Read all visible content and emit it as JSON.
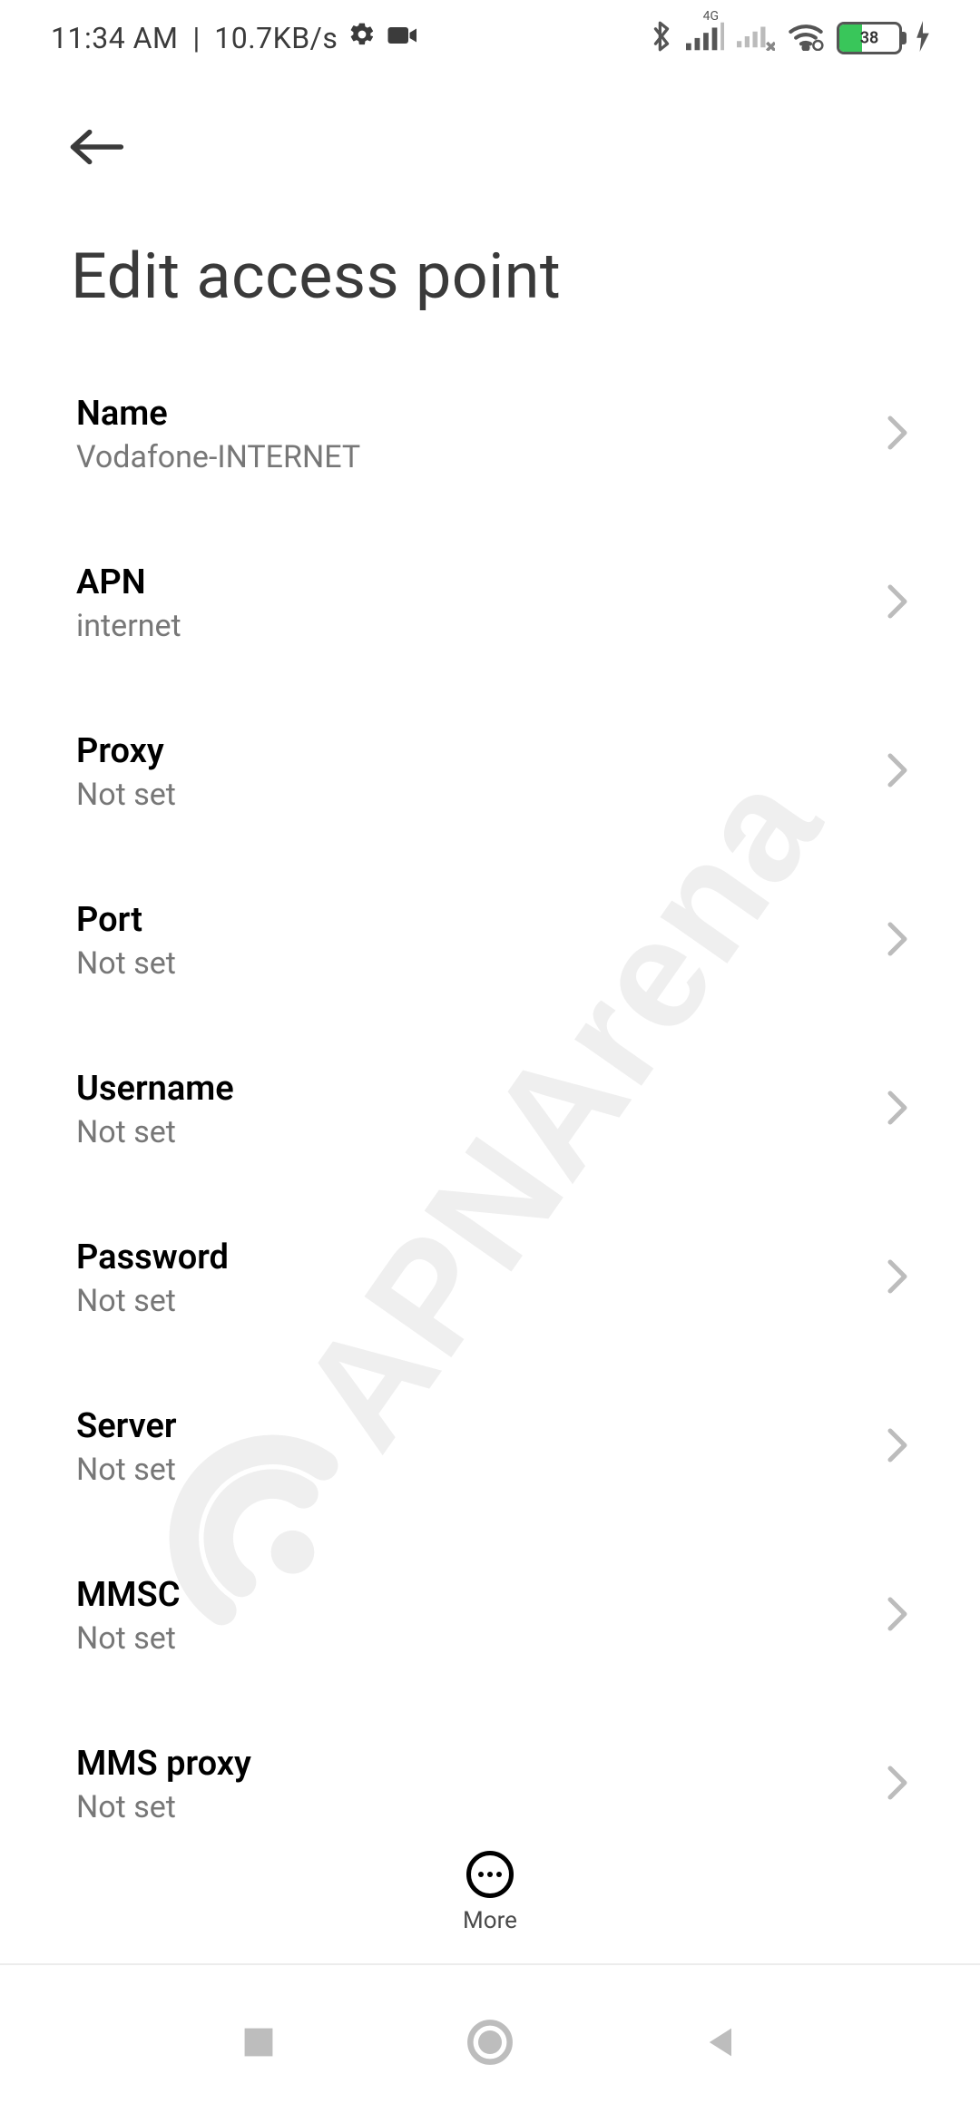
{
  "status": {
    "time": "11:34 AM",
    "net_speed": "10.7KB/s",
    "sim1_network": "4G",
    "battery_pct": 38,
    "battery_text": "38"
  },
  "header": {
    "title": "Edit access point"
  },
  "fields": [
    {
      "label": "Name",
      "value": "Vodafone-INTERNET"
    },
    {
      "label": "APN",
      "value": "internet"
    },
    {
      "label": "Proxy",
      "value": "Not set"
    },
    {
      "label": "Port",
      "value": "Not set"
    },
    {
      "label": "Username",
      "value": "Not set"
    },
    {
      "label": "Password",
      "value": "Not set"
    },
    {
      "label": "Server",
      "value": "Not set"
    },
    {
      "label": "MMSC",
      "value": "Not set"
    },
    {
      "label": "MMS proxy",
      "value": "Not set"
    }
  ],
  "toolbar": {
    "more_label": "More"
  },
  "watermark": "APNArena"
}
